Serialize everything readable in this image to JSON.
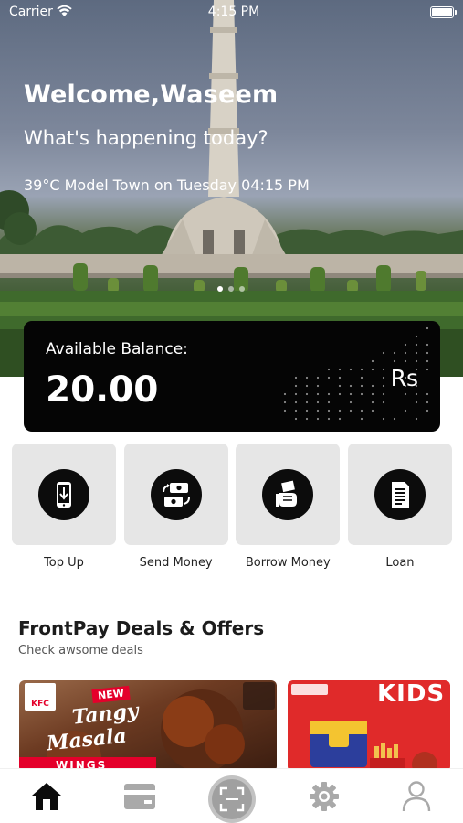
{
  "status_bar": {
    "carrier": "Carrier",
    "time": "4:15 PM"
  },
  "hero": {
    "welcome": "Welcome,Waseem",
    "subtitle": "What's happening today?",
    "weather": "39°C Model Town on Tuesday 04:15 PM",
    "slides": 3,
    "active_slide": 0
  },
  "balance": {
    "label": "Available Balance:",
    "amount": "20.00",
    "currency": "Rs"
  },
  "actions": [
    {
      "label": "Top Up",
      "icon": "phone-topup-icon"
    },
    {
      "label": "Send Money",
      "icon": "send-money-icon"
    },
    {
      "label": "Borrow Money",
      "icon": "borrow-money-icon"
    },
    {
      "label": "Loan",
      "icon": "loan-bill-icon"
    }
  ],
  "deals": {
    "title": "FrontPay Deals & Offers",
    "subtitle": "Check awsome deals",
    "cards": [
      {
        "brand": "KFC",
        "badge": "NEW",
        "headline_1": "Tangy",
        "headline_2": "Masala",
        "headline_3": "WINGS"
      },
      {
        "headline": "KIDS"
      }
    ]
  },
  "tabbar": {
    "items": [
      {
        "icon": "home-icon",
        "active": true
      },
      {
        "icon": "wallet-card-icon",
        "active": false
      },
      {
        "icon": "scan-icon",
        "active": false
      },
      {
        "icon": "gear-icon",
        "active": false
      },
      {
        "icon": "profile-icon",
        "active": false
      }
    ]
  },
  "colors": {
    "accent": "#000000",
    "tile_bg": "#e6e6e6",
    "icon_inactive": "#a9a9a9",
    "deal_red": "#e02a2a"
  }
}
